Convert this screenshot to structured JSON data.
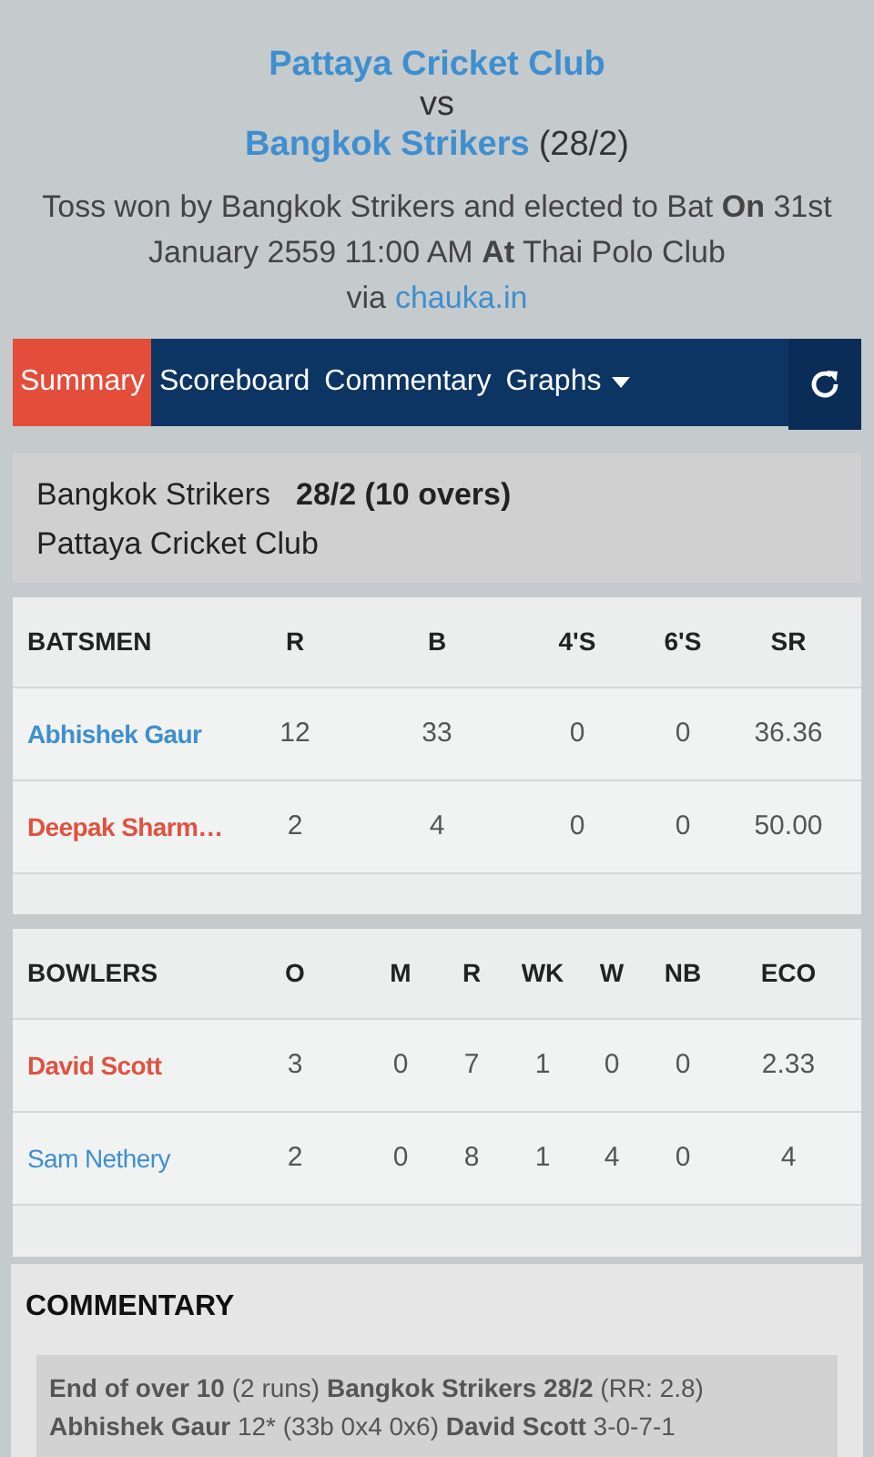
{
  "header": {
    "home_team": "Pattaya Cricket Club",
    "vs": "vs",
    "away_team": "Bangkok Strikers",
    "away_score": "(28/2)",
    "toss": "Toss won by Bangkok Strikers and elected to Bat **On** 31st January 2559 11:00 AM **At** Thai Polo Club",
    "via": "via",
    "source_link": "chauka.in"
  },
  "tabs": [
    {
      "label": "Summary",
      "selected": true
    },
    {
      "label": "Scoreboard",
      "selected": false
    },
    {
      "label": "Commentary",
      "selected": false
    },
    {
      "label": "Graphs",
      "selected": false,
      "dropdown": true
    }
  ],
  "score_card": {
    "batting_team": "Bangkok Strikers",
    "score": "28/2 (10 overs)",
    "bowling_team": "Pattaya Cricket Club"
  },
  "batsmen": {
    "columns": [
      "BATSMEN",
      "R",
      "B",
      "4'S",
      "6'S",
      "SR"
    ],
    "rows": [
      {
        "name": "Abhishek Gaur",
        "color": "#3f8fcf",
        "values": [
          "12",
          "33",
          "0",
          "0",
          "36.36"
        ]
      },
      {
        "name": "Deepak Sharm…",
        "color": "#e0523f",
        "values": [
          "2",
          "4",
          "0",
          "0",
          "50.00"
        ]
      }
    ]
  },
  "bowlers": {
    "columns": [
      "BOWLERS",
      "O",
      "M",
      "R",
      "WK",
      "W",
      "NB",
      "ECO"
    ],
    "rows": [
      {
        "name": "David Scott",
        "color": "#e0523f",
        "bold": true,
        "values": [
          "3",
          "0",
          "7",
          "1",
          "0",
          "0",
          "2.33"
        ]
      },
      {
        "name": "Sam Nethery",
        "color": "#3f8fcf",
        "bold": false,
        "values": [
          "2",
          "0",
          "8",
          "1",
          "4",
          "0",
          "4"
        ]
      }
    ]
  },
  "commentary": {
    "title": "COMMENTARY",
    "lines": [
      "**End of over 10** (2 runs) **Bangkok Strikers 28/2** (RR: 2.8)",
      "**Abhishek Gaur** 12* (33b 0x4 0x6) **David Scott** 3-0-7-1"
    ]
  }
}
